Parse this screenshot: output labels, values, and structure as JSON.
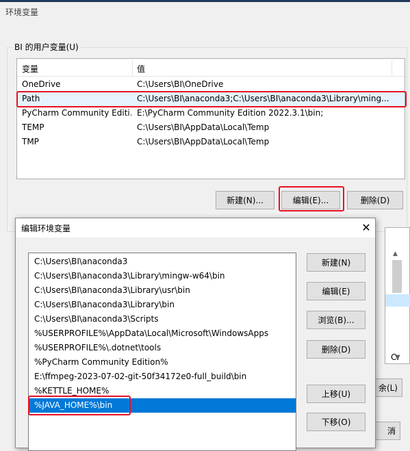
{
  "window": {
    "title": "环境变量"
  },
  "user_vars": {
    "group_label": "BI 的用户变量(U)",
    "columns": {
      "name": "变量",
      "value": "值"
    },
    "rows": [
      {
        "name": "OneDrive",
        "value": "C:\\Users\\BI\\OneDrive"
      },
      {
        "name": "Path",
        "value": "C:\\Users\\BI\\anaconda3;C:\\Users\\BI\\anaconda3\\Library\\ming..."
      },
      {
        "name": "PyCharm Community Editi...",
        "value": "E:\\PyCharm Community Edition 2022.3.1\\bin;"
      },
      {
        "name": "TEMP",
        "value": "C:\\Users\\BI\\AppData\\Local\\Temp"
      },
      {
        "name": "TMP",
        "value": "C:\\Users\\BI\\AppData\\Local\\Temp"
      }
    ],
    "buttons": {
      "new": "新建(N)...",
      "edit": "编辑(E)...",
      "delete": "删除(D)"
    }
  },
  "edit_dialog": {
    "title": "编辑环境变量",
    "close_glyph": "✕",
    "items": [
      "C:\\Users\\BI\\anaconda3",
      "C:\\Users\\BI\\anaconda3\\Library\\mingw-w64\\bin",
      "C:\\Users\\BI\\anaconda3\\Library\\usr\\bin",
      "C:\\Users\\BI\\anaconda3\\Library\\bin",
      "C:\\Users\\BI\\anaconda3\\Scripts",
      "%USERPROFILE%\\AppData\\Local\\Microsoft\\WindowsApps",
      "%USERPROFILE%\\.dotnet\\tools",
      "%PyCharm Community Edition%",
      "E:\\ffmpeg-2023-07-02-git-50f34172e0-full_build\\bin",
      "%KETTLE_HOME%",
      "%JAVA_HOME%\\bin"
    ],
    "selected_index": 10,
    "buttons": {
      "new": "新建(N)",
      "edit": "编辑(E)",
      "browse": "浏览(B)...",
      "delete": "删除(D)",
      "move_up": "上移(U)",
      "move_down": "下移(O)"
    }
  },
  "background": {
    "partial_cell": "C:",
    "partial_btn1": "余(L)",
    "partial_btn2": "消"
  },
  "colors": {
    "highlight": "#e81123",
    "selection": "#0078d7",
    "accent": "#0078d7"
  }
}
